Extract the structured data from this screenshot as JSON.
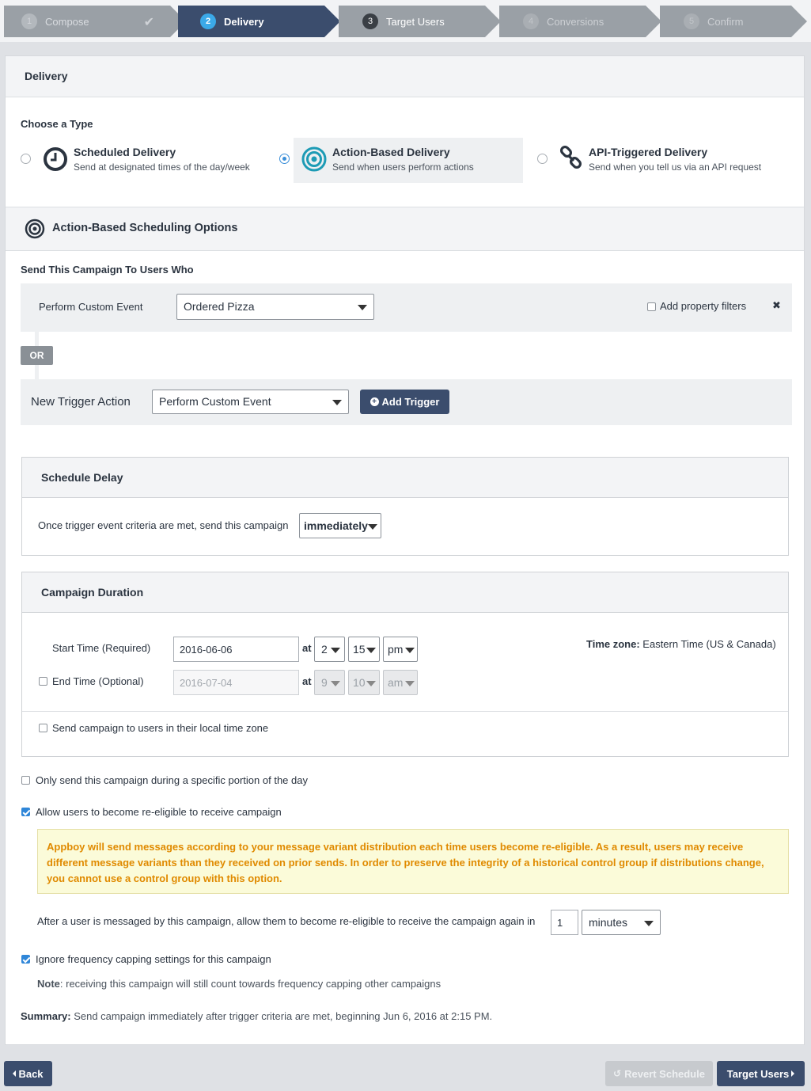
{
  "steps": [
    {
      "num": "1",
      "label": "Compose"
    },
    {
      "num": "2",
      "label": "Delivery"
    },
    {
      "num": "3",
      "label": "Target Users"
    },
    {
      "num": "4",
      "label": "Conversions"
    },
    {
      "num": "5",
      "label": "Confirm"
    }
  ],
  "delivery": {
    "title": "Delivery",
    "choose_type": "Choose a Type",
    "types": [
      {
        "title": "Scheduled Delivery",
        "sub": "Send at designated times of the day/week",
        "icon": "clock-icon",
        "selected": false
      },
      {
        "title": "Action-Based Delivery",
        "sub": "Send when users perform actions",
        "icon": "target-icon",
        "selected": true
      },
      {
        "title": "API-Triggered Delivery",
        "sub": "Send when you tell us via an API request",
        "icon": "link-icon",
        "selected": false
      }
    ]
  },
  "action": {
    "title": "Action-Based Scheduling Options",
    "send_to": "Send This Campaign To Users Who",
    "trigger_label": "Perform Custom Event",
    "trigger_value": "Ordered Pizza",
    "property_filters": "Add property filters",
    "remove": "✖",
    "or_label": "OR",
    "new_trigger_label": "New Trigger Action",
    "new_trigger_value": "Perform Custom Event",
    "add_trigger": "Add Trigger"
  },
  "delay": {
    "title": "Schedule Delay",
    "text": "Once trigger event criteria are met, send this campaign",
    "value": "immediately"
  },
  "duration": {
    "title": "Campaign Duration",
    "start_label": "Start Time (Required)",
    "start_date": "2016-06-06",
    "start_at": "at",
    "start_hour": "2",
    "start_min": "15",
    "start_ampm": "pm",
    "end_label": "End Time (Optional)",
    "end_date": "2016-07-04",
    "end_at": "at",
    "end_hour": "9",
    "end_min": "10",
    "end_ampm": "am",
    "tz_label": "Time zone:",
    "tz_value": "Eastern Time (US & Canada)",
    "local_tz": "Send campaign to users in their local time zone"
  },
  "options": {
    "portion_of_day": "Only send this campaign during a specific portion of the day",
    "reeligible": "Allow users to become re-eligible to receive campaign",
    "warning": "Appboy will send messages according to your message variant distribution each time users become re-eligible. As a result, users may receive different message variants than they received on prior sends. In order to preserve the integrity of a historical control group if distributions change, you cannot use a control group with this option.",
    "reeligible_text": "After a user is messaged by this campaign, allow them to become re-eligible to receive the campaign again in",
    "reeligible_value": "1",
    "reeligible_unit": "minutes",
    "ignore_capping": "Ignore frequency capping settings for this campaign",
    "note_label": "Note",
    "note_text": ": receiving this campaign will still count towards frequency capping other campaigns",
    "summary_label": "Summary:",
    "summary_text": "Send campaign immediately after trigger criteria are met, beginning Jun 6, 2016 at 2:15 PM."
  },
  "footer": {
    "back": "Back",
    "revert": "Revert Schedule",
    "next": "Target Users"
  },
  "colors": {
    "primary": "#3b4d6d",
    "accent": "#3ba9e8",
    "warning_text": "#e08a00",
    "warning_bg": "#fbfbd9"
  }
}
